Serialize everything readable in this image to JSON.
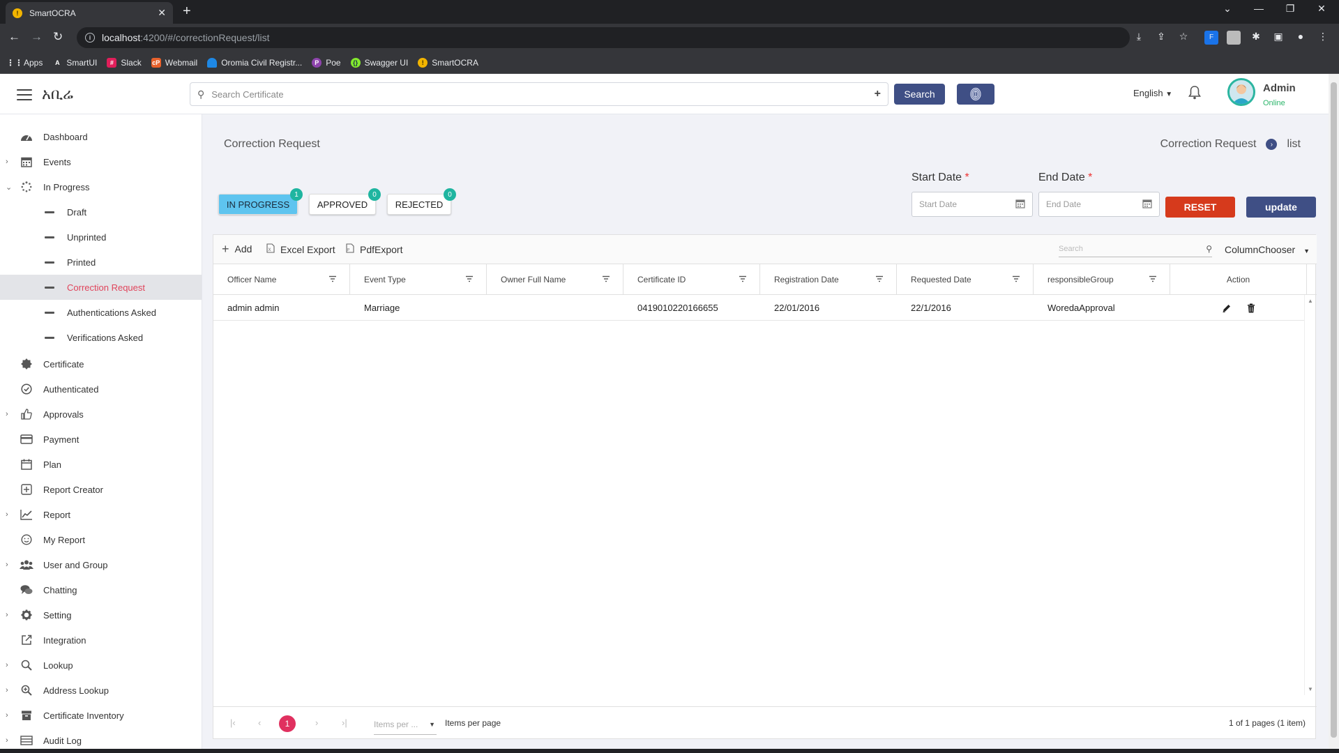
{
  "browser": {
    "tab_title": "SmartOCRA",
    "url_host": "localhost",
    "url_path": ":4200/#/correctionRequest/list",
    "bookmarks": [
      "Apps",
      "SmartUI",
      "Slack",
      "Webmail",
      "Oromia Civil Registr...",
      "Poe",
      "Swagger UI",
      "SmartOCRA"
    ]
  },
  "header": {
    "brand": "አቢሬ",
    "search_placeholder": "Search Certificate",
    "search_button": "Search",
    "language": "English",
    "user_name": "Admin",
    "user_status": "Online"
  },
  "sidebar": {
    "items": [
      {
        "label": "Dashboard",
        "icon": "dashboard-icon"
      },
      {
        "label": "Events",
        "icon": "calendar-icon"
      },
      {
        "label": "In Progress",
        "icon": "spinner-icon"
      },
      {
        "label": "Draft"
      },
      {
        "label": "Unprinted"
      },
      {
        "label": "Printed"
      },
      {
        "label": "Correction Request"
      },
      {
        "label": "Authentications Asked"
      },
      {
        "label": "Verifications Asked"
      },
      {
        "label": "Certificate",
        "icon": "certificate-icon"
      },
      {
        "label": "Authenticated",
        "icon": "check-circle-icon"
      },
      {
        "label": "Approvals",
        "icon": "thumbs-up-icon"
      },
      {
        "label": "Payment",
        "icon": "credit-card-icon"
      },
      {
        "label": "Plan",
        "icon": "calendar-icon"
      },
      {
        "label": "Report Creator",
        "icon": "plus-square-icon"
      },
      {
        "label": "Report",
        "icon": "line-chart-icon"
      },
      {
        "label": "My Report",
        "icon": "smile-icon"
      },
      {
        "label": "User and Group",
        "icon": "users-icon"
      },
      {
        "label": "Chatting",
        "icon": "chat-icon"
      },
      {
        "label": "Setting",
        "icon": "gear-icon"
      },
      {
        "label": "Integration",
        "icon": "external-link-icon"
      },
      {
        "label": "Lookup",
        "icon": "search-icon"
      },
      {
        "label": "Address Lookup",
        "icon": "zoom-icon"
      },
      {
        "label": "Certificate Inventory",
        "icon": "archive-icon"
      },
      {
        "label": "Audit Log",
        "icon": "list-icon"
      }
    ]
  },
  "page": {
    "title": "Correction Request",
    "breadcrumb_parent": "Correction Request",
    "breadcrumb_current": "list"
  },
  "status_tabs": [
    {
      "label": "IN PROGRESS",
      "count": "1"
    },
    {
      "label": "APPROVED",
      "count": "0"
    },
    {
      "label": "REJECTED",
      "count": "0"
    }
  ],
  "filters": {
    "start_label": "Start Date",
    "start_placeholder": "Start Date",
    "end_label": "End Date",
    "end_placeholder": "End Date",
    "required_mark": "*",
    "reset_label": "RESET",
    "update_label": "update"
  },
  "grid": {
    "toolbar": {
      "add": "Add",
      "excel": "Excel Export",
      "pdf": "PdfExport",
      "search_placeholder": "Search",
      "column_chooser": "ColumnChooser"
    },
    "columns": [
      "Officer Name",
      "Event Type",
      "Owner Full Name",
      "Certificate ID",
      "Registration Date",
      "Requested Date",
      "responsibleGroup",
      "Action"
    ],
    "rows": [
      {
        "officer_name": "admin admin",
        "event_type": "Marriage",
        "owner_full_name": "",
        "certificate_id": "0419010220166655",
        "registration_date": "22/01/2016",
        "requested_date": "22/1/2016",
        "responsible_group": "WoredaApproval"
      }
    ],
    "pager": {
      "current_page": "1",
      "items_per_placeholder": "Items per ...",
      "items_per_label": "Items per page",
      "info": "1 of 1 pages (1 item)"
    }
  }
}
